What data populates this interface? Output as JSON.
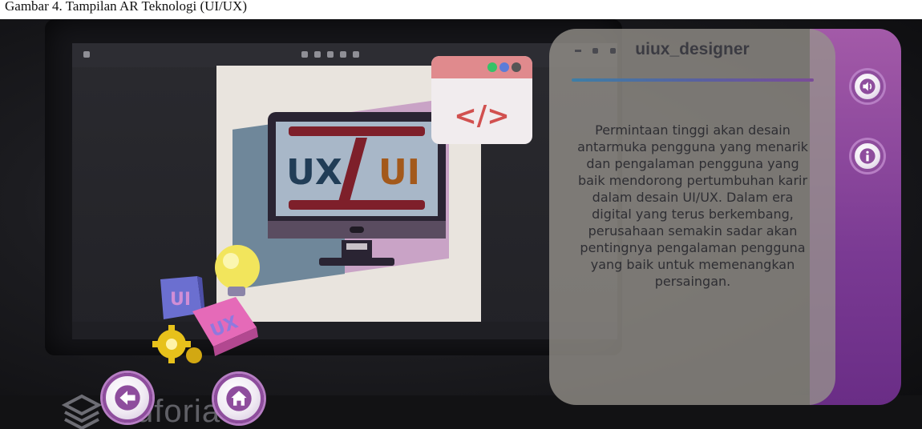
{
  "caption": "Gambar 4. Tampilan AR Teknologi (UI/UX)",
  "info_panel": {
    "title": "uiux_designer",
    "description": "Permintaan tinggi akan desain antarmuka pengguna yang menarik dan pengalaman pengguna yang baik mendorong pertumbuhan karir dalam desain UI/UX. Dalam era digital yang terus berkembang, perusahaan semakin sadar akan pentingnya pengalaman pengguna yang baik untuk memenangkan persaingan."
  },
  "illustration": {
    "ux_text": "UX",
    "ui_text": "UI",
    "code_symbol": "</>",
    "ui_cube_label": "UI",
    "ux_cube_label": "UX"
  },
  "buttons": {
    "audio_icon": "speaker-icon",
    "info_icon": "info-icon",
    "back_icon": "arrow-left-icon",
    "home_icon": "home-icon"
  },
  "watermark": {
    "text": "vuforia"
  },
  "colors": {
    "accent_purple": "#8e4d9d",
    "panel_gradient_start": "#3d7ea6",
    "panel_gradient_end": "#7b4c98"
  }
}
